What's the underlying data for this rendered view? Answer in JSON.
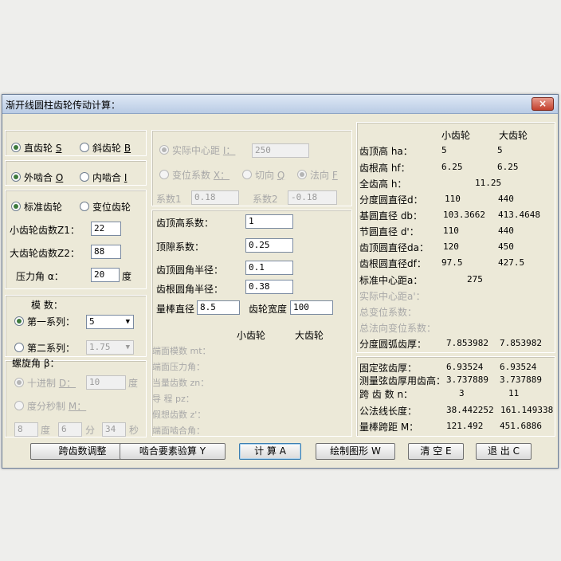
{
  "window": {
    "title": "渐开线圆柱齿轮传动计算：",
    "close_icon": "×"
  },
  "left": {
    "gear_type": {
      "opt1": "直齿轮",
      "opt1_key": "S",
      "opt2": "斜齿轮",
      "opt2_key": "B"
    },
    "mesh_type": {
      "opt1": "外啮合",
      "opt1_key": "O",
      "opt2": "内啮合",
      "opt2_key": "I"
    },
    "gear_kind": {
      "opt1": "标准齿轮",
      "opt2": "变位齿轮"
    },
    "z1_label": "小齿轮齿数Z1：",
    "z1_value": "22",
    "z2_label": "大齿轮齿数Z2：",
    "z2_value": "88",
    "alpha_label": "压力角  α：",
    "alpha_value": "20",
    "alpha_unit": "度",
    "module_label": "模  数：",
    "series1_label": "第一系列：",
    "series1_value": "5",
    "series2_label": "第二系列：",
    "series2_value": "1.75",
    "helix_label": "螺旋角  β：",
    "decimal_label": "十进制",
    "decimal_key": "D：",
    "decimal_value": "10",
    "decimal_unit": "度",
    "dms_label": "度分秒制",
    "dms_key": "M：",
    "deg_value": "8",
    "deg_unit": "度",
    "min_value": "6",
    "min_unit": "分",
    "sec_value": "34",
    "sec_unit": "秒"
  },
  "middle": {
    "actual_center_label": "实际中心距",
    "actual_center_key": "I：",
    "actual_center_value": "250",
    "shift_coef_label": "变位系数",
    "shift_coef_key": "X：",
    "tangent_label": "切向",
    "tangent_key": "Q",
    "normal_label": "法向",
    "normal_key": "F",
    "coef1_label": "系数1",
    "coef1_value": "0.18",
    "coef2_label": "系数2",
    "coef2_value": "-0.18",
    "addendum_coef_label": "齿顶高系数：",
    "addendum_coef_value": "1",
    "clearance_coef_label": "顶隙系数：",
    "clearance_coef_value": "0.25",
    "tip_radius_label": "齿顶圆角半径：",
    "tip_radius_value": "0.1",
    "root_radius_label": "齿根圆角半径：",
    "root_radius_value": "0.38",
    "pin_dia_label": "量棒直径",
    "pin_dia_value": "8.5",
    "face_width_label": "齿轮宽度",
    "face_width_value": "100",
    "col_small": "小齿轮",
    "col_large": "大齿轮",
    "end_module": "端面模数  mt：",
    "end_pressure": "端面压力角：",
    "equiv_teeth": "当量齿数  zn：",
    "lead": "导    程  pz：",
    "virtual_teeth": "假想齿数  z'：",
    "end_mesh_angle": "端面啮合角："
  },
  "right": {
    "col_small": "小齿轮",
    "col_large": "大齿轮",
    "rows1": [
      {
        "label": "齿顶高  ha：",
        "small": "5",
        "large": "5"
      },
      {
        "label": "齿根高  hf：",
        "small": "6.25",
        "large": "6.25"
      }
    ],
    "whole_depth": {
      "label": "全齿高  h：",
      "value": "11.25"
    },
    "rows2": [
      {
        "label": "分度圆直径d：",
        "small": "110",
        "large": "440"
      },
      {
        "label": "基圆直径  db：",
        "small": "103.3662",
        "large": "413.4648"
      },
      {
        "label": "节圆直径  d'：",
        "small": "110",
        "large": "440"
      },
      {
        "label": "齿顶圆直径da：",
        "small": "120",
        "large": "450"
      },
      {
        "label": "齿根圆直径df：",
        "small": "97.5",
        "large": "427.5"
      }
    ],
    "std_center": {
      "label": "标准中心距a：",
      "value": "275"
    },
    "actual_center_label": "实际中心距a'：",
    "total_shift_label": "总变位系数：",
    "total_normal_shift_label": "总法向变位系数：",
    "pitch_arc": {
      "label": "分度圆弧齿厚：",
      "small": "7.853982",
      "large": "7.853982"
    },
    "chord": {
      "label": "固定弦齿厚：",
      "small": "6.93524",
      "large": "6.93524"
    },
    "chord_height": {
      "label": "测量弦齿厚用齿高：",
      "small": "3.737889",
      "large": "3.737889"
    },
    "span_teeth": {
      "label": "跨 齿 数  n：",
      "small": "3",
      "large": "11"
    },
    "base_tangent": {
      "label": "公法线长度：",
      "small": "38.442252",
      "large": "161.149338"
    },
    "over_pins": {
      "label": "量棒跨距  M：",
      "small": "121.492",
      "large": "451.6886"
    }
  },
  "buttons": {
    "span_adjust": "跨齿数调整",
    "mesh_check": "啮合要素验算 Y",
    "calculate": "计 算 A",
    "draw": "绘制图形 W",
    "clear": "清 空 E",
    "exit": "退 出 C"
  }
}
